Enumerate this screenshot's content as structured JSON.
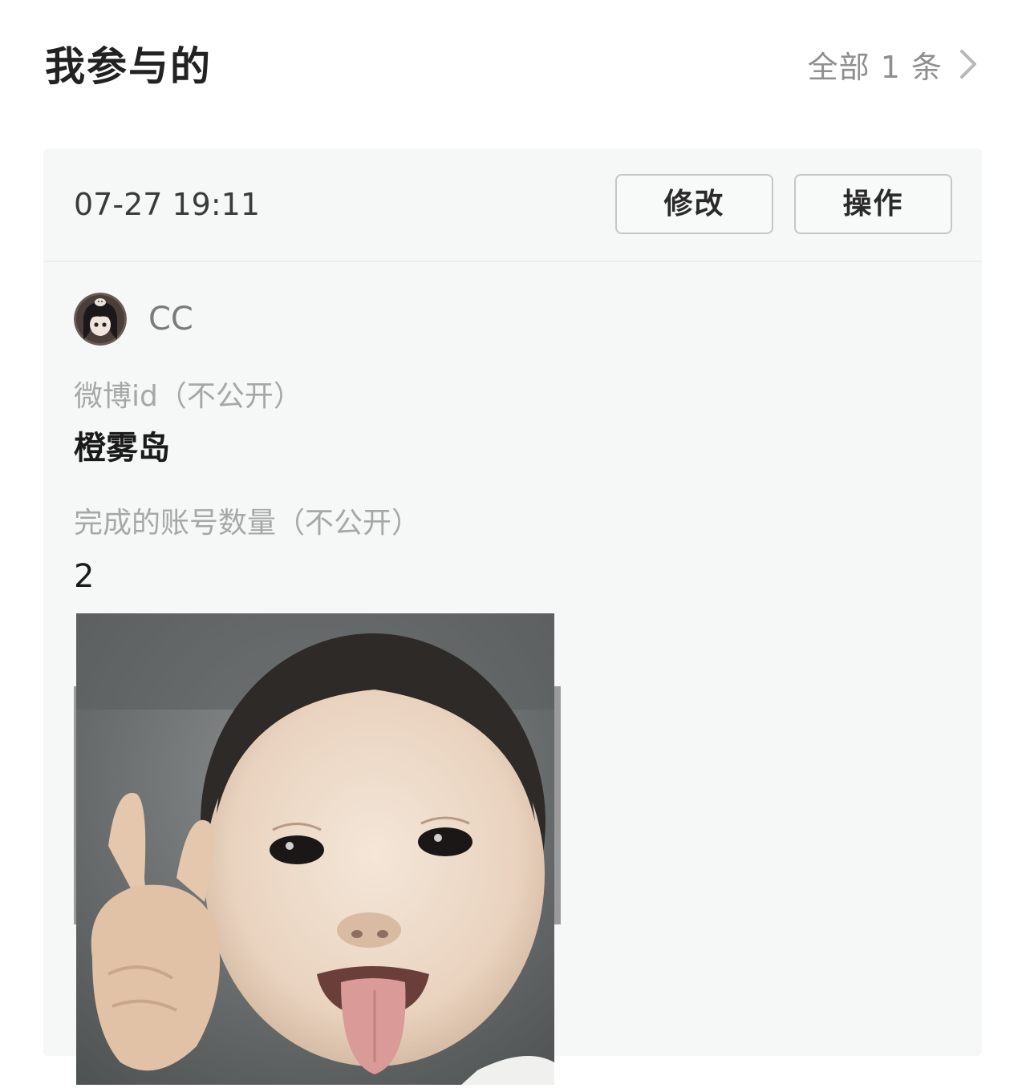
{
  "header": {
    "title": "我参与的",
    "view_all_label": "全部 1 条"
  },
  "entry": {
    "timestamp": "07-27 19:11",
    "edit_label": "修改",
    "action_label": "操作",
    "user": {
      "name": "CC"
    },
    "fields": [
      {
        "label": "微博id（不公开）",
        "value": "橙雾岛"
      },
      {
        "label": "完成的账号数量（不公开）",
        "value": "2"
      }
    ]
  },
  "icons": {
    "view_all": "chevron-right-icon",
    "avatar": "anime-girl-avatar",
    "photo": "child-peace-sign-photo"
  },
  "colors": {
    "card_background": "#f6f8f8",
    "label_gray": "#a7a7a7",
    "button_border": "#c6c6c6"
  }
}
